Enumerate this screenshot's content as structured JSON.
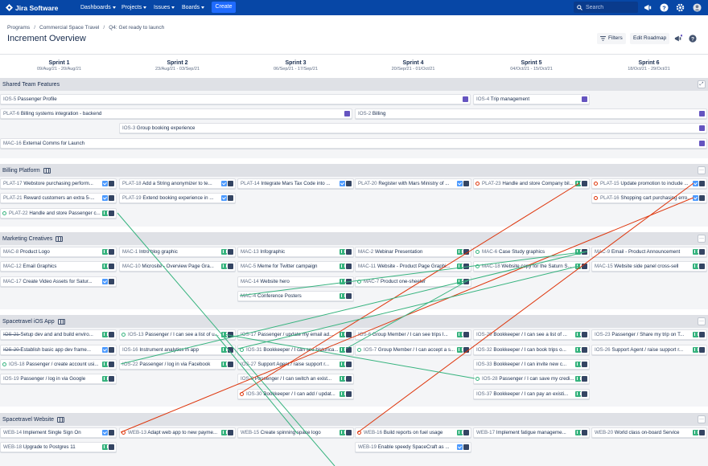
{
  "app": {
    "name": "Jira Software"
  },
  "nav": [
    {
      "label": "Dashboards"
    },
    {
      "label": "Projects"
    },
    {
      "label": "Issues"
    },
    {
      "label": "Boards"
    }
  ],
  "create_label": "Create",
  "search": {
    "placeholder": "Search"
  },
  "breadcrumb": [
    "Programs",
    "Commercial Space Travel",
    "Q4: Get ready to launch"
  ],
  "page_title": "Increment Overview",
  "header_buttons": {
    "filters": "Filters",
    "edit_roadmap": "Edit Roadmap"
  },
  "sprints": [
    {
      "name": "Sprint 1",
      "dates": "09/Aug/21 - 20/Aug/21"
    },
    {
      "name": "Sprint 2",
      "dates": "23/Aug/21 - 03/Sep/21"
    },
    {
      "name": "Sprint 3",
      "dates": "06/Sep/21 - 17/Sep/21"
    },
    {
      "name": "Sprint 4",
      "dates": "20/Sep/21 - 01/Oct/21"
    },
    {
      "name": "Sprint 5",
      "dates": "04/Oct/21 - 15/Oct/21"
    },
    {
      "name": "Sprint 6",
      "dates": "18/Oct/21 - 29/Oct/21"
    }
  ],
  "teams": [
    {
      "name": "Shared Team Features"
    },
    {
      "name": "Billing Platform"
    },
    {
      "name": "Marketing Creatives"
    },
    {
      "name": "Spacetravel iOS App"
    },
    {
      "name": "Spacetravel Website"
    }
  ],
  "cards": [
    {
      "key": "IOS-5",
      "title": "Passenger Profile"
    },
    {
      "key": "IOS-4",
      "title": "Trip management"
    },
    {
      "key": "PLAT-6",
      "title": "Billing systems integration - backend"
    },
    {
      "key": "IOS-2",
      "title": "Billing"
    },
    {
      "key": "IOS-3",
      "title": "Group booking experience"
    },
    {
      "key": "MAC-16",
      "title": "External Comms for Launch"
    },
    {
      "key": "PLAT-17",
      "title": "Webstore purchasing perform..."
    },
    {
      "key": "PLAT-18",
      "title": "Add a String anonymizer to te..."
    },
    {
      "key": "PLAT-14",
      "title": "Integrate Mars Tax Code into ..."
    },
    {
      "key": "PLAT-20",
      "title": "Register with Mars Ministry of ..."
    },
    {
      "key": "PLAT-23",
      "title": "Handle and store Company bil..."
    },
    {
      "key": "PLAT-15",
      "title": "Update promotion to include ..."
    },
    {
      "key": "PLAT-21",
      "title": "Reward customers an extra 5-..."
    },
    {
      "key": "PLAT-19",
      "title": "Extend booking experience in ..."
    },
    {
      "key": "PLAT-16",
      "title": "Shopping cart purchasing erro..."
    },
    {
      "key": "PLAT-22",
      "title": "Handle and store Passenger c..."
    },
    {
      "key": "MAC-8",
      "title": "Product Logo"
    },
    {
      "key": "MAC-1",
      "title": "Intro blog graphic"
    },
    {
      "key": "MAC-13",
      "title": "Infographic"
    },
    {
      "key": "MAC-2",
      "title": "Webinar Presentation"
    },
    {
      "key": "MAC-6",
      "title": "Case Study graphics"
    },
    {
      "key": "MAC-9",
      "title": "Email - Product Announcement"
    },
    {
      "key": "MAC-12",
      "title": "Email Graphics"
    },
    {
      "key": "MAC-10",
      "title": "Microsite - Overview Page Gra..."
    },
    {
      "key": "MAC-5",
      "title": "Meme for Twitter campaign"
    },
    {
      "key": "MAC-11",
      "title": "Website - Product Page Graphi..."
    },
    {
      "key": "MAC-18",
      "title": "Website copy for the Saturn S..."
    },
    {
      "key": "MAC-15",
      "title": "Website side panel cross-sell"
    },
    {
      "key": "MAC-17",
      "title": "Create Video Assets for Satur..."
    },
    {
      "key": "MAC-14",
      "title": "Website hero"
    },
    {
      "key": "MAC-7",
      "title": "Product one-sheeter"
    },
    {
      "key": "MAC-4",
      "title": "Conference Posters"
    },
    {
      "key": "IOS-21",
      "title": "Setup dev and and build enviro..."
    },
    {
      "key": "IOS-13",
      "title": "Passenger / I can see a list of u..."
    },
    {
      "key": "IOS-17",
      "title": "Passenger / update my email ad..."
    },
    {
      "key": "IOS-6",
      "title": "Group Member / I can see trips I..."
    },
    {
      "key": "IOS-29",
      "title": "Bookkeeper / I can see a list of ..."
    },
    {
      "key": "IOS-23",
      "title": "Passenger / Share my trip on T..."
    },
    {
      "key": "IOS-20",
      "title": "Establish basic app dev frame..."
    },
    {
      "key": "IOS-16",
      "title": "Instrument analytics in app"
    },
    {
      "key": "IOS-31",
      "title": "Bookkeeper / I can see historica..."
    },
    {
      "key": "IOS-7",
      "title": "Group Member / I can accept a s..."
    },
    {
      "key": "IOS-32",
      "title": "Bookkeeper / I can book trips o..."
    },
    {
      "key": "IOS-26",
      "title": "Support Agent / raise support r..."
    },
    {
      "key": "IOS-18",
      "title": "Passenger / create account usi..."
    },
    {
      "key": "IOS-22",
      "title": "Passenger / log in via Facebook"
    },
    {
      "key": "IOS-27",
      "title": "Support Agent / raise support r..."
    },
    {
      "key": "IOS-33",
      "title": "Bookkeeper / I can invite new c..."
    },
    {
      "key": "IOS-19",
      "title": "Passenger / log in via Google"
    },
    {
      "key": "IOS-9",
      "title": "Passenger / I can switch an exist..."
    },
    {
      "key": "IOS-28",
      "title": "Passenger / I can save my credi..."
    },
    {
      "key": "IOS-30",
      "title": "Bookkeeper / I can add / updat..."
    },
    {
      "key": "IOS-37",
      "title": "Bookkeeper / I can pay an existi..."
    },
    {
      "key": "WEB-14",
      "title": "Implement Single Sign On"
    },
    {
      "key": "WEB-13",
      "title": "Adapt web app to new payme..."
    },
    {
      "key": "WEB-15",
      "title": "Create spinning space logo"
    },
    {
      "key": "WEB-16",
      "title": "Build reports on fuel usage"
    },
    {
      "key": "WEB-17",
      "title": "Implement fatigue manageme..."
    },
    {
      "key": "WEB-20",
      "title": "World class on-board Service"
    },
    {
      "key": "WEB-18",
      "title": "Upgrade to Postgres 11"
    },
    {
      "key": "WEB-19",
      "title": "Enable speedy SpaceCraft as ..."
    }
  ],
  "colors": {
    "topbar": "#0747a6",
    "create": "#1f6bff",
    "story": "#36b37e",
    "task": "#4c9aff",
    "epic": "#6554c0",
    "dep_red": "#de350b",
    "dep_green": "#36b37e"
  }
}
